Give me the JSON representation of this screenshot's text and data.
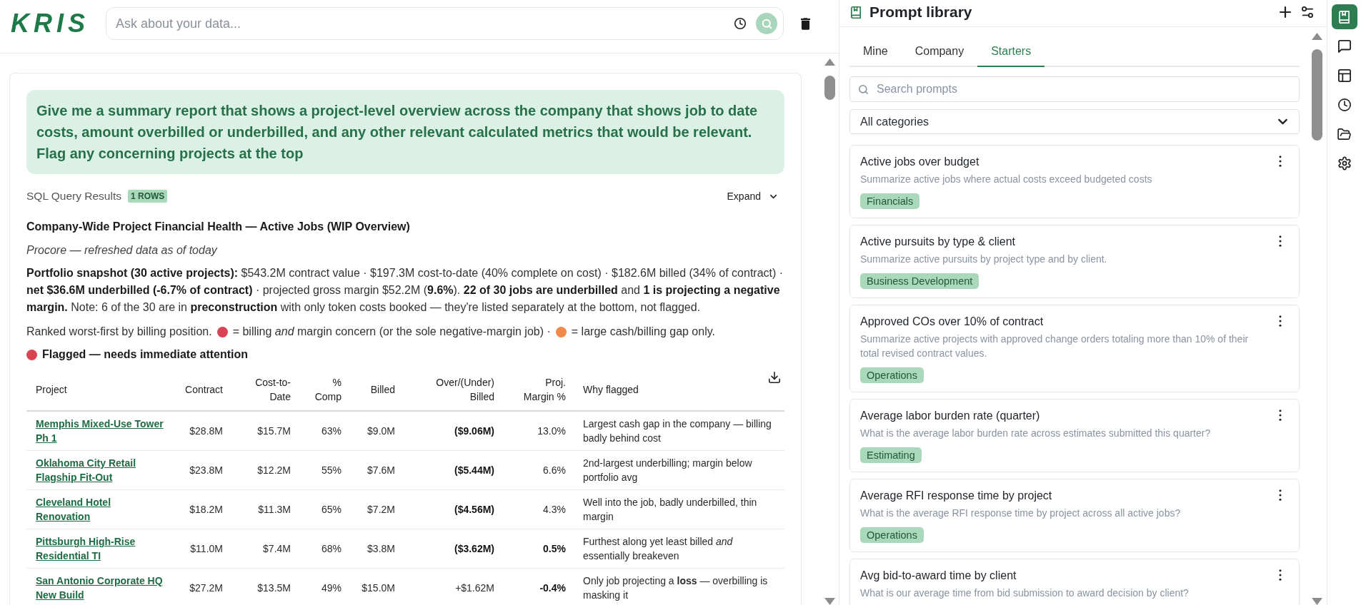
{
  "header": {
    "logo": "KRIS",
    "search": {
      "placeholder": "Ask about your data..."
    }
  },
  "chat": {
    "user_message": "Give me a summary report that shows a project-level overview across the company that shows job to date costs, amount overbilled or underbilled, and any other relevant calculated metrics that would be relevant. Flag any concerning projects at the top",
    "results": {
      "label": "SQL Query Results",
      "badge": "1 ROWS",
      "expand": "Expand",
      "title": "Company-Wide Project Financial Health — Active Jobs (WIP Overview)",
      "source_note": "Procore — refreshed data as of today",
      "summary": "**Portfolio snapshot (30 active projects):** $543.2M contract value · $197.3M cost-to-date (40% complete on cost) · $182.6M billed (34% of contract) · **net $36.6M underbilled (-6.7% of contract)** · projected gross margin $52.2M (**9.6%**). **22 of 30 jobs are underbilled** and **1 is projecting a negative margin.** Note: 6 of the 30 are in **preconstruction** with only token costs booked — they're listed separately at the bottom, not flagged.",
      "legend": [
        {
          "kind": "text",
          "text": "Ranked worst-first by billing position."
        },
        {
          "kind": "dot",
          "color": "#d94452"
        },
        {
          "kind": "text",
          "text": "= billing *and* margin concern (or the sole negative-margin job) ·"
        },
        {
          "kind": "dot",
          "color": "#f08a4b"
        },
        {
          "kind": "text",
          "text": "= large cash/billing gap only."
        }
      ],
      "flagged_heading": {
        "color": "#d94452",
        "text": "Flagged — needs immediate attention"
      },
      "table": {
        "columns": [
          "Project",
          "Contract",
          "Cost-to-Date",
          "% Comp",
          "Billed",
          "Over/(Under) Billed",
          "Proj. Margin %",
          "Why flagged"
        ],
        "rows": [
          {
            "project": "Memphis Mixed-Use Tower Ph 1",
            "contract": "$28.8M",
            "cost_to_date": "$15.7M",
            "percent_complete": "63%",
            "billed": "$9.0M",
            "over_under_billed": {
              "text": "($9.06M)",
              "strong": true
            },
            "projected_margin": {
              "text": "13.0%",
              "strong": false
            },
            "why_flagged": "Largest cash gap in the company — billing badly behind cost"
          },
          {
            "project": "Oklahoma City Retail Flagship Fit-Out",
            "contract": "$23.8M",
            "cost_to_date": "$12.2M",
            "percent_complete": "55%",
            "billed": "$7.6M",
            "over_under_billed": {
              "text": "($5.44M)",
              "strong": true
            },
            "projected_margin": {
              "text": "6.6%",
              "strong": false
            },
            "why_flagged": "2nd-largest underbilling; margin below portfolio avg"
          },
          {
            "project": "Cleveland Hotel Renovation",
            "contract": "$18.2M",
            "cost_to_date": "$11.3M",
            "percent_complete": "65%",
            "billed": "$7.2M",
            "over_under_billed": {
              "text": "($4.56M)",
              "strong": true
            },
            "projected_margin": {
              "text": "4.3%",
              "strong": false
            },
            "why_flagged": "Well into the job, badly underbilled, thin margin"
          },
          {
            "project": "Pittsburgh High-Rise Residential TI",
            "contract": "$11.0M",
            "cost_to_date": "$7.4M",
            "percent_complete": "68%",
            "billed": "$3.8M",
            "over_under_billed": {
              "text": "($3.62M)",
              "strong": true
            },
            "projected_margin": {
              "text": "0.5%",
              "strong": true
            },
            "why_flagged": "Furthest along yet least billed *and* essentially breakeven"
          },
          {
            "project": "San Antonio Corporate HQ New Build",
            "contract": "$27.2M",
            "cost_to_date": "$13.5M",
            "percent_complete": "49%",
            "billed": "$15.0M",
            "over_under_billed": {
              "text": "+$1.62M",
              "strong": false
            },
            "projected_margin": {
              "text": "-0.4%",
              "strong": true
            },
            "why_flagged": "Only job projecting a **loss** — overbilling is masking it"
          }
        ]
      }
    }
  },
  "prompt_library": {
    "title": "Prompt library",
    "tabs": [
      {
        "label": "Mine",
        "selected": false
      },
      {
        "label": "Company",
        "selected": false
      },
      {
        "label": "Starters",
        "selected": true
      }
    ],
    "search": {
      "placeholder": "Search prompts"
    },
    "category": {
      "value": "All categories"
    },
    "prompts": [
      {
        "title": "Active jobs over budget",
        "description": "Summarize active jobs where actual costs exceed budgeted costs",
        "tag": "Financials"
      },
      {
        "title": "Active pursuits by type & client",
        "description": "Summarize active pursuits by project type and by client.",
        "tag": "Business Development"
      },
      {
        "title": "Approved COs over 10% of contract",
        "description": "Summarize active projects with approved change orders totaling more than 10% of their total revised contract values.",
        "tag": "Operations"
      },
      {
        "title": "Average labor burden rate (quarter)",
        "description": "What is the average labor burden rate across estimates submitted this quarter?",
        "tag": "Estimating"
      },
      {
        "title": "Average RFI response time by project",
        "description": "What is the average RFI response time by project across all active jobs?",
        "tag": "Operations"
      },
      {
        "title": "Avg bid-to-award time by client",
        "description": "What is our average time from bid submission to award decision by client?"
      }
    ]
  },
  "rail": [
    {
      "kind": "prompts",
      "selected": true
    },
    {
      "kind": "chat",
      "selected": false
    },
    {
      "kind": "tables",
      "selected": false
    },
    {
      "kind": "history",
      "selected": false
    },
    {
      "kind": "files",
      "selected": false
    },
    {
      "kind": "settings",
      "selected": false
    }
  ]
}
